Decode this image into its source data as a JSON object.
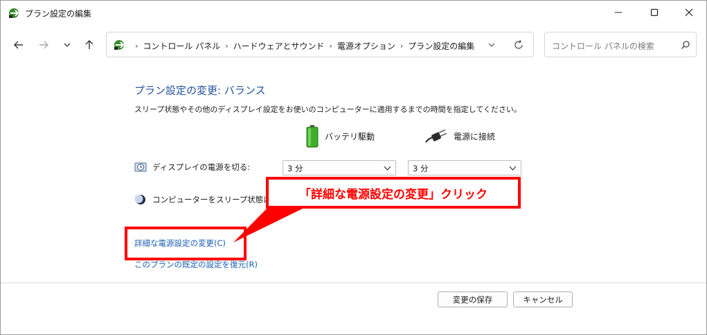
{
  "window": {
    "title": "プラン設定の編集",
    "controls": {
      "minimize_icon": "minimize-icon",
      "maximize_icon": "maximize-icon",
      "close_icon": "close-icon"
    }
  },
  "navigation": {
    "breadcrumbs": [
      "コントロール パネル",
      "ハードウェアとサウンド",
      "電源オプション",
      "プラン設定の編集"
    ],
    "search_placeholder": "コントロール パネルの検索"
  },
  "main": {
    "heading": "プラン設定の変更: バランス",
    "description": "スリープ状態やその他のディスプレイ設定をお使いのコンピューターに適用するまでの時間を指定してください。",
    "columns": {
      "battery": "バッテリ駆動",
      "plugged_in": "電源に接続"
    },
    "display_off": {
      "label": "ディスプレイの電源を切る:",
      "battery_value": "3 分",
      "plugged_in_value": "3 分"
    },
    "sleep": {
      "label": "コンピューターをスリープ状態にす"
    },
    "advanced_link": "詳細な電源設定の変更(C)",
    "restore_link": "このプランの既定の設定を復元(R)"
  },
  "footer": {
    "save_button": "変更の保存",
    "cancel_button": "キャンセル"
  },
  "annotation": {
    "callout_text": "「詳細な電源設定の変更」クリック",
    "color": "#ff0000"
  },
  "colors": {
    "heading": "#1e4f9c",
    "link": "#1a5fb4",
    "accent_red": "#ff0000"
  }
}
